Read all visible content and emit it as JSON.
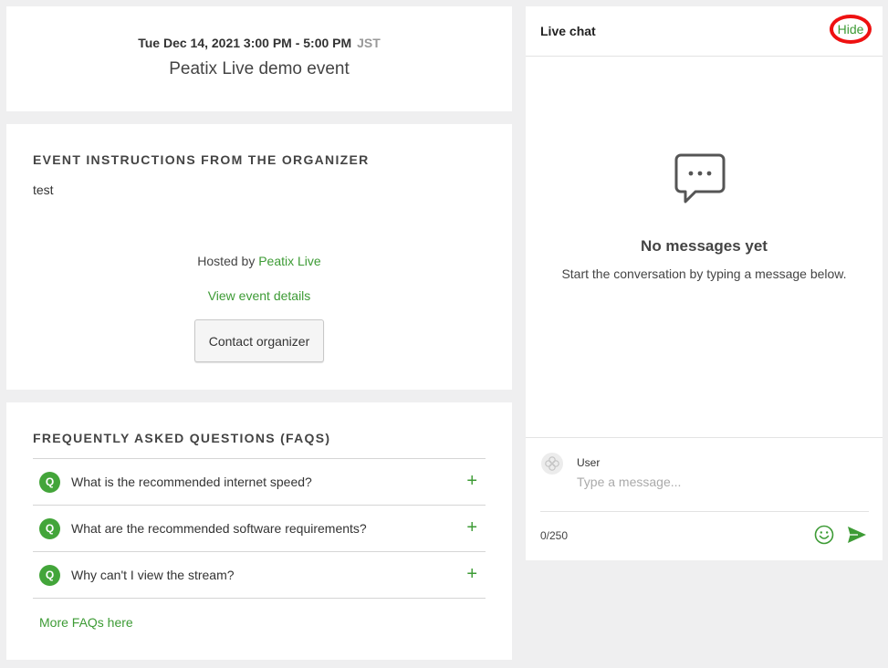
{
  "event": {
    "date_time": "Tue Dec 14, 2021 3:00 PM - 5:00 PM",
    "timezone": "JST",
    "title": "Peatix Live demo event"
  },
  "instructions": {
    "heading": "EVENT INSTRUCTIONS FROM THE ORGANIZER",
    "text": "test",
    "hosted_by_prefix": "Hosted by",
    "host_name": "Peatix Live",
    "view_details": "View event details",
    "contact_button": "Contact organizer"
  },
  "faq": {
    "heading": "FREQUENTLY ASKED QUESTIONS (FAQS)",
    "badge": "Q",
    "expand_symbol": "+",
    "items": [
      {
        "question": "What is the recommended internet speed?"
      },
      {
        "question": "What are the recommended software requirements?"
      },
      {
        "question": "Why can't I view the stream?"
      }
    ],
    "more_link": "More FAQs here"
  },
  "chat": {
    "title": "Live chat",
    "hide_label": "Hide",
    "empty_title": "No messages yet",
    "empty_subtitle": "Start the conversation by typing a message below.",
    "user_name": "User",
    "input_placeholder": "Type a message...",
    "char_count": "0/250"
  },
  "colors": {
    "accent_green": "#3d9b35",
    "highlight_red": "#ee1111",
    "background": "#efeff0"
  },
  "icons": [
    "chat-bubble-icon",
    "avatar-icon",
    "emoji-icon",
    "send-icon"
  ]
}
